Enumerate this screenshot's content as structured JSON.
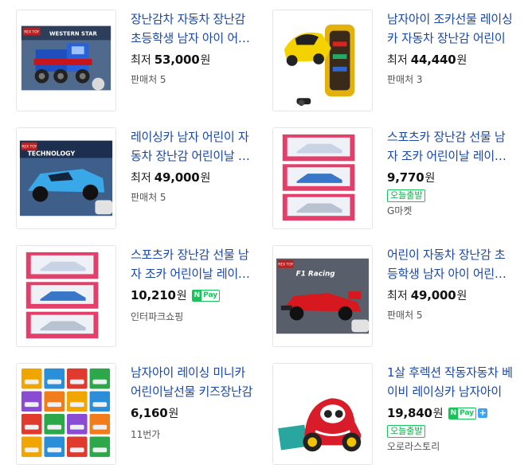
{
  "products": [
    {
      "title": "장난감차 자동차 장난감 초등학생 남자 아이 어린이",
      "price_prefix": "최저",
      "price": "53,000",
      "won": "원",
      "seller": "판매처 5",
      "npay": false,
      "plus": false,
      "badge": ""
    },
    {
      "title": "남자아이 조카선물 레이싱카 자동차 장난감 어린이",
      "price_prefix": "최저",
      "price": "44,440",
      "won": "원",
      "seller": "판매처 3",
      "npay": false,
      "plus": false,
      "badge": ""
    },
    {
      "title": "레이싱카 남자 어린이 자동차 장난감 어린이날 선물",
      "price_prefix": "최저",
      "price": "49,000",
      "won": "원",
      "seller": "판매처 5",
      "npay": false,
      "plus": false,
      "badge": ""
    },
    {
      "title": "스포츠카 장난감 선물 남자 조카 어린이날 레이싱카",
      "price_prefix": "",
      "price": "9,770",
      "won": "원",
      "seller": "G마켓",
      "npay": false,
      "plus": false,
      "badge": "오늘출발"
    },
    {
      "title": "스포츠카 장난감 선물 남자 조카 어린이날 레이싱카",
      "price_prefix": "",
      "price": "10,210",
      "won": "원",
      "seller": "인터파크쇼핑",
      "npay": true,
      "plus": false,
      "badge": ""
    },
    {
      "title": "어린이 자동차 장난감 초등학생 남자 아이 어린이날",
      "price_prefix": "최저",
      "price": "49,000",
      "won": "원",
      "seller": "판매처 5",
      "npay": false,
      "plus": false,
      "badge": ""
    },
    {
      "title": "남자아이 레이싱 미니카 어린이날선물 키즈장난감",
      "price_prefix": "",
      "price": "6,160",
      "won": "원",
      "seller": "11번가",
      "npay": false,
      "plus": false,
      "badge": ""
    },
    {
      "title": "1살 후렉션 작동자동차 베이비 레이싱카 남자아이",
      "price_prefix": "",
      "price": "19,840",
      "won": "원",
      "seller": "오로라스토리",
      "npay": true,
      "plus": true,
      "badge": "오늘출발"
    }
  ],
  "npay_label": {
    "n": "N",
    "pay": "Pay"
  },
  "plus_label": "+",
  "images": {
    "img0": {
      "brand": "REX TOY",
      "text": "WESTERN STAR"
    },
    "img2": {
      "brand": "REX TOY",
      "text": "TECHNOLOGY"
    },
    "img5": {
      "brand": "REX TOY",
      "text": "F1 Racing"
    }
  },
  "colors": {
    "title_link": "#1a47a8",
    "npay_green": "#18c35a",
    "badge_green": "#18a84f"
  }
}
